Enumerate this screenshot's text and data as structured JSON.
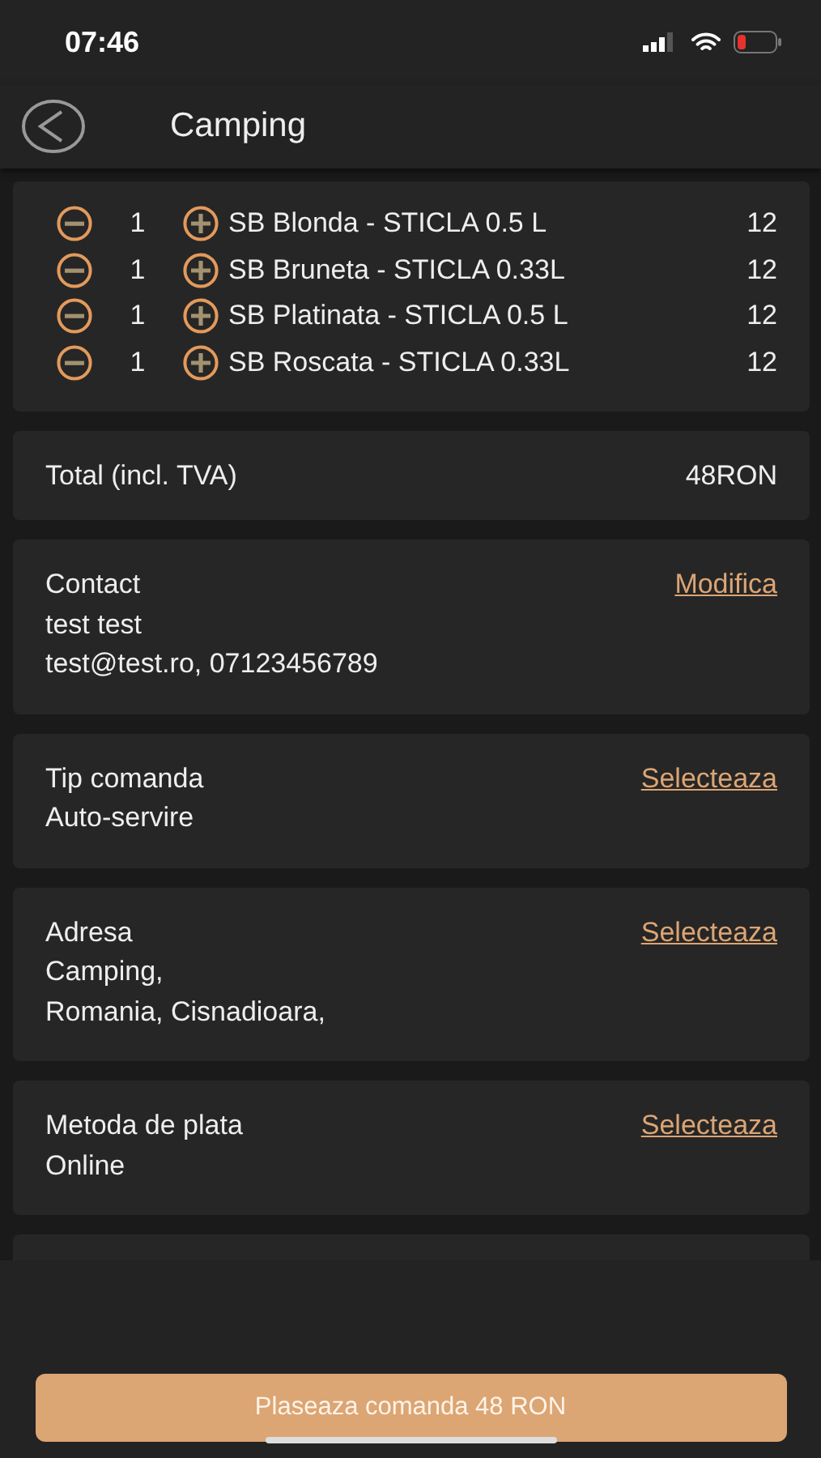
{
  "status_bar": {
    "time": "07:46"
  },
  "header": {
    "title": "Camping"
  },
  "items": [
    {
      "quantity": "1",
      "name": "SB Blonda - STICLA 0.5 L",
      "price": "12"
    },
    {
      "quantity": "1",
      "name": "SB Bruneta - STICLA 0.33L",
      "price": "12"
    },
    {
      "quantity": "1",
      "name": "SB Platinata - STICLA 0.5 L",
      "price": "12"
    },
    {
      "quantity": "1",
      "name": "SB Roscata - STICLA 0.33L",
      "price": "12"
    }
  ],
  "total": {
    "label": "Total (incl. TVA)",
    "value": "48RON"
  },
  "sections": [
    {
      "title": "Contact",
      "action": "Modifica",
      "lines": [
        "test test",
        "test@test.ro,  07123456789"
      ]
    },
    {
      "title": "Tip comanda",
      "action": "Selecteaza",
      "lines": [
        "Auto-servire"
      ]
    },
    {
      "title": "Adresa",
      "action": "Selecteaza",
      "lines": [
        "Camping,",
        "Romania, Cisnadioara,"
      ]
    },
    {
      "title": "Metoda de plata",
      "action": "Selecteaza",
      "lines": [
        "Online"
      ]
    }
  ],
  "place_order_button": "Plaseaza comanda 48 RON"
}
